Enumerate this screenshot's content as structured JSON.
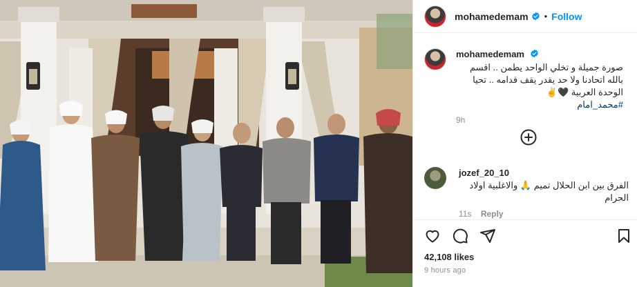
{
  "post": {
    "username": "mohamedemam",
    "follow_label": "Follow",
    "separator": "•"
  },
  "caption": {
    "username": "mohamedemam",
    "text": "صورة جميلة و تخلي الواحد يطمن .. اقسم بالله اتحادنا ولا حد يقدر يقف قدامه .. تحيا الوحدة العربية 🖤✌️",
    "hashtag": "#محمد_امام",
    "time": "9h"
  },
  "comment": {
    "username": "jozef_20_10",
    "text": "الفرق بين ابن الحلال تميم 🙏 والاغلبية اولاد الحرام",
    "time": "11s",
    "reply_label": "Reply"
  },
  "engagement": {
    "likes": "42,108 likes",
    "posted": "9 hours ago"
  },
  "icons": {
    "verified": "verified-badge-icon",
    "like": "heart-icon",
    "comment": "comment-icon",
    "share": "send-icon",
    "save": "bookmark-icon",
    "more": "plus-circle-icon"
  },
  "colors": {
    "link": "#0095f6",
    "hashtag": "#00376b",
    "muted": "#8e8e8e"
  }
}
